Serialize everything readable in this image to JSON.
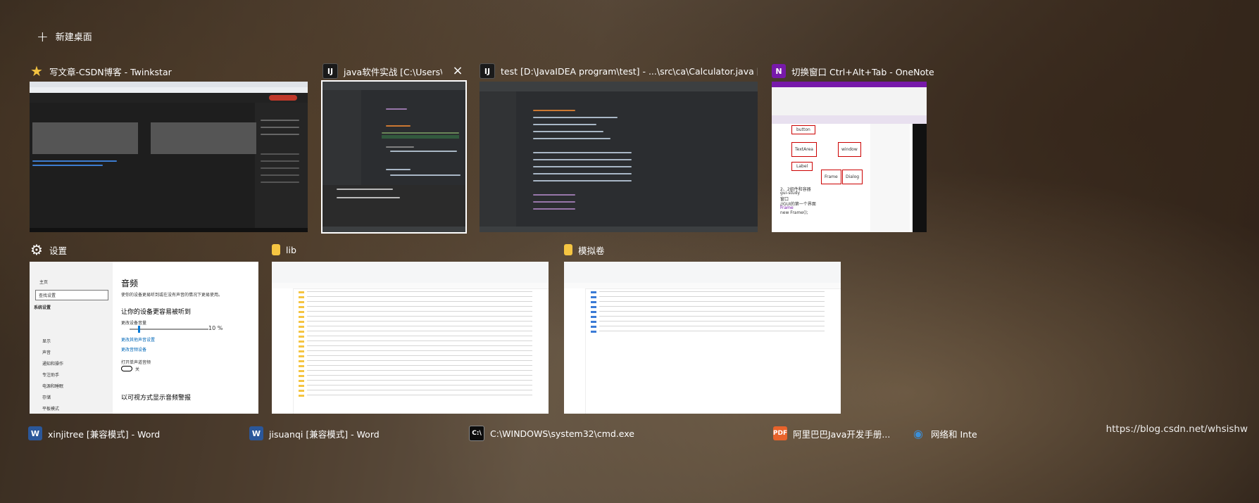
{
  "new_desktop": {
    "label": "新建桌面"
  },
  "windows": [
    {
      "title": "写文章-CSDN博客 - Twinkstar",
      "icon": "star-icon",
      "icon_color": "#f3c341"
    },
    {
      "title": "java软件实战 [C:\\Users\\王硕\\...",
      "icon": "intellij-icon",
      "icon_color": "#1a1a1a"
    },
    {
      "title": "test [D:\\JavaIDEA  program\\test] - ...\\src\\ca\\Calculator.java [test] - Intelli...",
      "icon": "intellij-icon",
      "icon_color": "#1a1a1a"
    },
    {
      "title": "切换窗口 Ctrl+Alt+Tab - OneNote",
      "icon": "onenote-icon",
      "icon_color": "#7719aa"
    },
    {
      "title": "设置",
      "icon": "gear-icon",
      "icon_color": "#ffffff"
    },
    {
      "title": "lib",
      "icon": "folder-icon",
      "icon_color": "#f5c542"
    },
    {
      "title": "模拟卷",
      "icon": "folder-icon",
      "icon_color": "#f5c542"
    }
  ],
  "settings_thumb": {
    "home": "主页",
    "search": "查找设置",
    "section": "系统设置",
    "side_items": [
      "显示",
      "声音",
      "通知和操作",
      "专注助手",
      "电源和睡眠",
      "存储",
      "平板模式"
    ],
    "heading": "音频",
    "desc": "使你的设备更易听到或在没有声音的情况下更易使用。",
    "sub1": "让你的设备更容易被听到",
    "volume_label": "更改设备音量",
    "volume_value": "10 %",
    "link1": "更改其他声音设置",
    "link2": "更改音频设备",
    "mono": "打开单声道音频",
    "toggle": "关",
    "sub2": "以可视方式显示音频警报"
  },
  "onenote_thumb": {
    "boxes": [
      "button",
      "TextArea",
      "window",
      "Frame",
      "Dialog",
      "Label"
    ],
    "notes": [
      "2、2组件和容器",
      "gui-study",
      "窗口",
      "//GUI的第一个界面",
      "Frame",
      "new Frame();"
    ]
  },
  "taskbar": [
    {
      "label": "xinjitree [兼容模式] - Word",
      "icon": "word-icon",
      "icon_color": "#2b579a"
    },
    {
      "label": "jisuanqi [兼容模式] - Word",
      "icon": "word-icon",
      "icon_color": "#2b579a"
    },
    {
      "label": "C:\\WINDOWS\\system32\\cmd.exe",
      "icon": "cmd-icon",
      "icon_color": "#0c0c0c"
    },
    {
      "label": "阿里巴巴Java开发手册...",
      "icon": "pdf-icon",
      "icon_color": "#e8632b"
    },
    {
      "label": "网络和 Inte",
      "icon": "network-icon",
      "icon_color": "#3b8fd9"
    }
  ],
  "watermark": "https://blog.csdn.net/whsishw"
}
